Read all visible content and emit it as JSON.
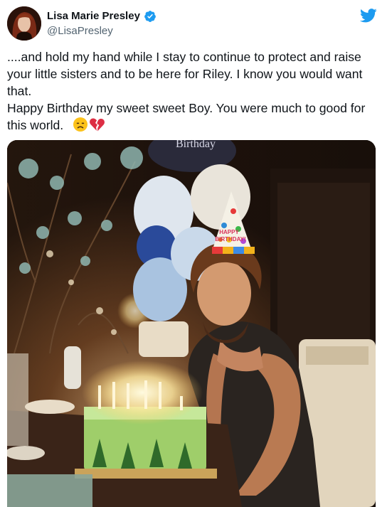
{
  "author": {
    "display_name": "Lisa Marie Presley",
    "handle": "@LisaPresley",
    "verified_icon": "verified-badge-icon",
    "avatar_icon": "avatar"
  },
  "platform_icon": "twitter-bird-icon",
  "tweet": {
    "line1": "....and hold my hand while I stay to continue to protect and raise your little sisters and to be here for Riley. I know you would want that.",
    "line2": "Happy Birthday my sweet sweet Boy. You were much to good for this world.",
    "emojis": [
      "disappointed-face-emoji",
      "broken-heart-emoji"
    ]
  },
  "media": {
    "balloon_text": "Birthday",
    "hat_text_1": "HAPPY",
    "hat_text_2": "BIRTHDAY!"
  },
  "colors": {
    "twitter_blue": "#1d9bf0",
    "handle_gray": "#536471",
    "text": "#0f1419"
  }
}
